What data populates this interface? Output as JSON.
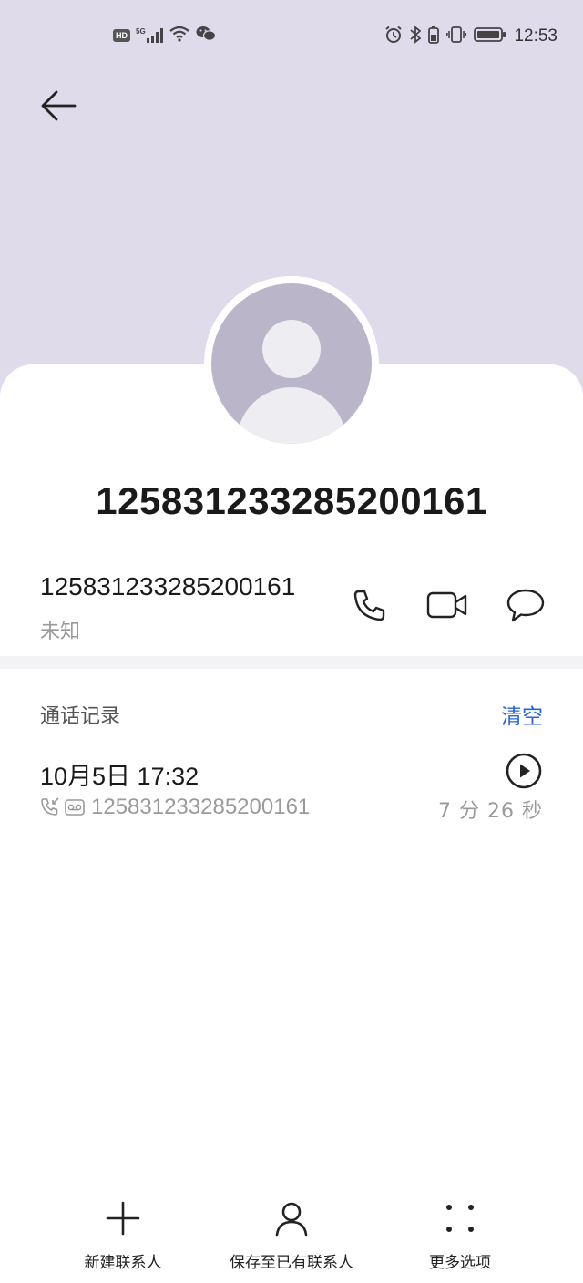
{
  "status_bar": {
    "hd_badge": "HD",
    "network": "5G",
    "time": "12:53"
  },
  "contact": {
    "title": "125831233285200161",
    "number": "125831233285200161",
    "number_label": "未知"
  },
  "actions": {
    "call_icon": "phone-icon",
    "video_icon": "video-call-icon",
    "message_icon": "message-icon"
  },
  "call_log": {
    "section_title": "通话记录",
    "clear_label": "清空",
    "entries": [
      {
        "datetime": "10月5日 17:32",
        "number": "125831233285200161",
        "duration": "7 分 26 秒",
        "call_type_icon": "incoming-call-icon",
        "recording_icon": "voicemail-icon"
      }
    ]
  },
  "bottom_bar": {
    "items": [
      {
        "label": "新建联系人",
        "icon": "plus-icon"
      },
      {
        "label": "保存至已有联系人",
        "icon": "person-icon"
      },
      {
        "label": "更多选项",
        "icon": "more-dots-icon"
      }
    ]
  },
  "colors": {
    "header_bg": "#e0dbeb",
    "avatar_bg": "#bbb5c9",
    "accent": "#2a64d6"
  }
}
